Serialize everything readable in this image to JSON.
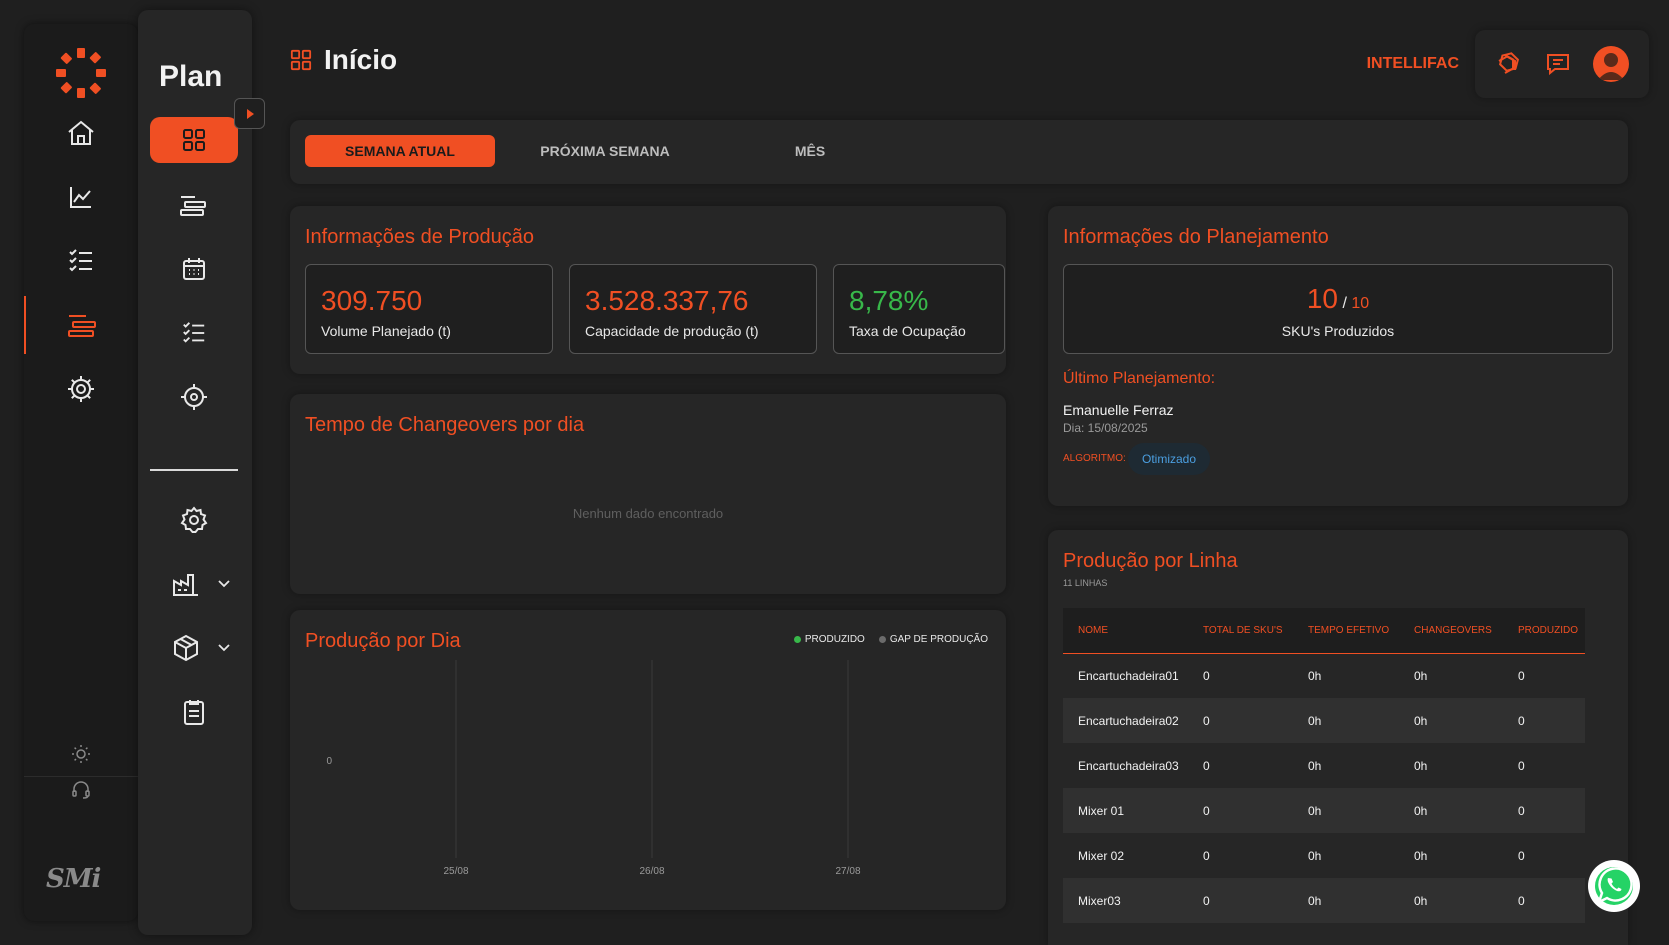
{
  "colors": {
    "accent": "#f04f23",
    "green": "#38b84a",
    "blue": "#4b9fe1",
    "background": "#1f1f1f"
  },
  "rail": {
    "items": [
      {
        "icon": "home-icon"
      },
      {
        "icon": "chart-line-icon"
      },
      {
        "icon": "checklist-icon"
      },
      {
        "icon": "gantt-icon",
        "active": true
      },
      {
        "icon": "settings-gear-icon"
      }
    ],
    "bottom": [
      {
        "icon": "sun-icon"
      },
      {
        "icon": "headset-icon"
      }
    ],
    "brand": "SMi"
  },
  "subnav": {
    "title": "Plan",
    "items": [
      {
        "icon": "grid-icon",
        "active": true
      },
      {
        "icon": "gantt-icon"
      },
      {
        "icon": "calendar-icon"
      },
      {
        "icon": "checklist-icon"
      },
      {
        "icon": "target-icon"
      },
      {
        "icon": "settings-icon"
      },
      {
        "icon": "factory-icon",
        "expandable": true
      },
      {
        "icon": "box-icon",
        "expandable": true
      },
      {
        "icon": "clipboard-icon"
      }
    ]
  },
  "header": {
    "title": "Início",
    "company": "INTELLIFAC"
  },
  "tabs": [
    {
      "label": "SEMANA ATUAL",
      "active": true
    },
    {
      "label": "PRÓXIMA SEMANA"
    },
    {
      "label": "MÊS"
    }
  ],
  "production_info": {
    "title": "Informações de Produção",
    "kpis": [
      {
        "value": "309.750",
        "label": "Volume Planejado (t)"
      },
      {
        "value": "3.528.337,76",
        "label": "Capacidade de produção (t)"
      },
      {
        "value": "8,78%",
        "label": "Taxa de Ocupação"
      }
    ]
  },
  "changeovers": {
    "title": "Tempo de Changeovers por dia",
    "empty": "Nenhum dado encontrado"
  },
  "production_by_day": {
    "title": "Produção por Dia",
    "legend": [
      {
        "label": "PRODUZIDO",
        "color": "#38b84a"
      },
      {
        "label": "GAP DE PRODUÇÃO",
        "color": "#6b6b6b"
      }
    ]
  },
  "chart_data": {
    "type": "bar",
    "title": "Produção por Dia",
    "categories": [
      "25/08",
      "26/08",
      "27/08"
    ],
    "series": [
      {
        "name": "PRODUZIDO",
        "values": [
          0,
          0,
          0
        ]
      },
      {
        "name": "GAP DE PRODUÇÃO",
        "values": [
          0,
          0,
          0
        ]
      }
    ],
    "y_ticks": [
      "0"
    ],
    "grid": true,
    "legend_position": "top-right"
  },
  "planning_info": {
    "title": "Informações do Planejamento",
    "sku_done": "10",
    "sku_sep": "/",
    "sku_total": "10",
    "sku_label": "SKU's Produzidos",
    "last_title": "Último Planejamento:",
    "planner": "Emanuelle Ferraz",
    "date": "Dia: 15/08/2025",
    "algo_label": "ALGORITMO:",
    "algo_value": "Otimizado"
  },
  "production_by_line": {
    "title": "Produção por Linha",
    "subtitle": "11 LINHAS",
    "columns": [
      "NOME",
      "TOTAL DE SKU'S",
      "TEMPO EFETIVO",
      "CHANGEOVERS",
      "PRODUZIDO"
    ],
    "rows": [
      [
        "Encartuchadeira01",
        "0",
        "0h",
        "0h",
        "0"
      ],
      [
        "Encartuchadeira02",
        "0",
        "0h",
        "0h",
        "0"
      ],
      [
        "Encartuchadeira03",
        "0",
        "0h",
        "0h",
        "0"
      ],
      [
        "Mixer 01",
        "0",
        "0h",
        "0h",
        "0"
      ],
      [
        "Mixer 02",
        "0",
        "0h",
        "0h",
        "0"
      ],
      [
        "Mixer03",
        "0",
        "0h",
        "0h",
        "0"
      ]
    ]
  }
}
